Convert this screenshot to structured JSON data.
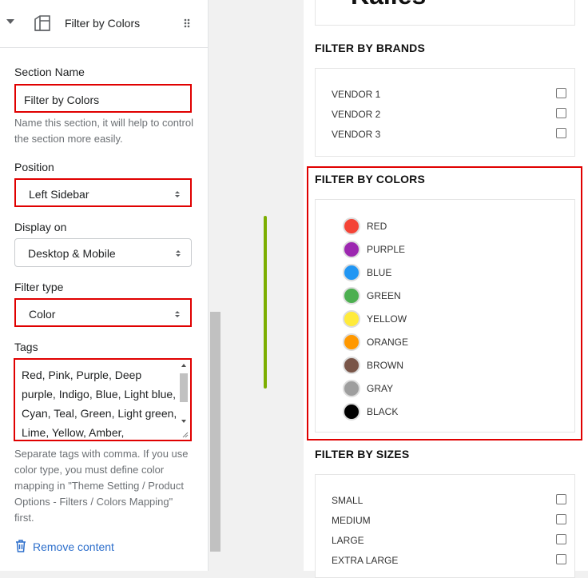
{
  "editor": {
    "header_title": "Filter by Colors",
    "section_name": {
      "label": "Section Name",
      "value": "Filter by Colors",
      "help": "Name this section, it will help to control the section more easily."
    },
    "position": {
      "label": "Position",
      "value": "Left Sidebar"
    },
    "display_on": {
      "label": "Display on",
      "value": "Desktop & Mobile"
    },
    "filter_type": {
      "label": "Filter type",
      "value": "Color"
    },
    "tags": {
      "label": "Tags",
      "value": "Red, Pink, Purple, Deep purple, Indigo, Blue, Light blue, Cyan, Teal, Green, Light green, Lime, Yellow, Amber,",
      "help": "Separate tags with comma. If you use color type, you must define color mapping in \"Theme Setting / Product Options - Filters / Colors Mapping\" first."
    },
    "remove_label": "Remove content"
  },
  "preview": {
    "logo_text": "Kalles",
    "brands": {
      "title": "FILTER BY BRANDS",
      "items": [
        "VENDOR 1",
        "VENDOR 2",
        "VENDOR 3"
      ]
    },
    "colors": {
      "title": "FILTER BY COLORS",
      "items": [
        {
          "name": "RED",
          "color": "#f44336"
        },
        {
          "name": "PURPLE",
          "color": "#9c27b0"
        },
        {
          "name": "BLUE",
          "color": "#2196f3"
        },
        {
          "name": "GREEN",
          "color": "#4caf50"
        },
        {
          "name": "YELLOW",
          "color": "#ffeb3b"
        },
        {
          "name": "ORANGE",
          "color": "#ff9800"
        },
        {
          "name": "BROWN",
          "color": "#795548"
        },
        {
          "name": "GRAY",
          "color": "#9e9e9e"
        },
        {
          "name": "BLACK",
          "color": "#000000"
        }
      ]
    },
    "sizes": {
      "title": "FILTER BY SIZES",
      "items": [
        "SMALL",
        "MEDIUM",
        "LARGE",
        "EXTRA LARGE"
      ]
    }
  },
  "colors": {
    "highlight": "#e00000",
    "link": "#2c6ecb",
    "scroll_accent": "#7cae00"
  }
}
